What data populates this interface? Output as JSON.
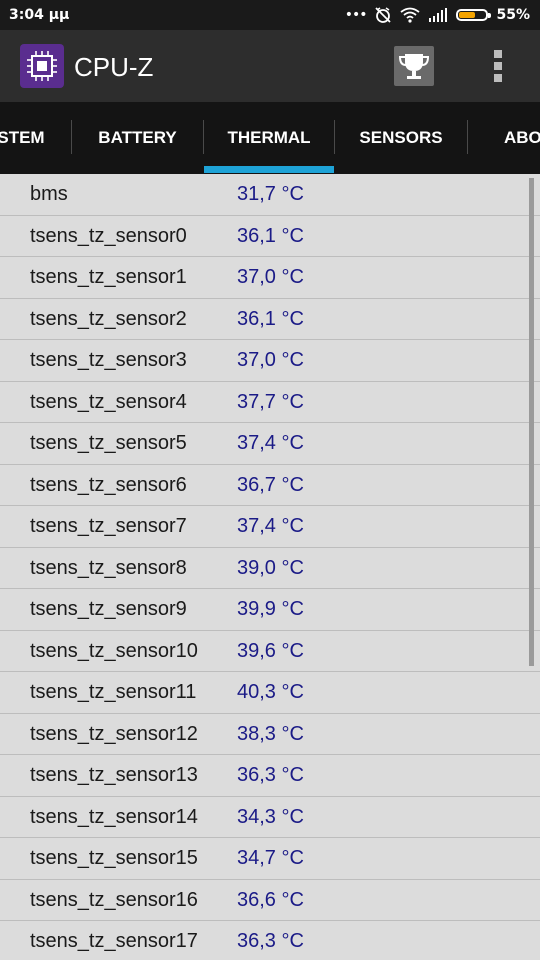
{
  "status_bar": {
    "time": "3:04 μμ",
    "battery_percent": "55%",
    "battery_level": 0.55
  },
  "app_bar": {
    "title": "CPU-Z",
    "icons": [
      "cpu-chip-logo",
      "trophy-icon",
      "more-vert-icon"
    ]
  },
  "tabs": [
    {
      "label": "STEM"
    },
    {
      "label": "BATTERY"
    },
    {
      "label": "THERMAL",
      "selected": true
    },
    {
      "label": "SENSORS"
    },
    {
      "label": "ABO"
    }
  ],
  "thermal": [
    {
      "name": "bms",
      "value": "31,7 °C"
    },
    {
      "name": "tsens_tz_sensor0",
      "value": "36,1 °C"
    },
    {
      "name": "tsens_tz_sensor1",
      "value": "37,0 °C"
    },
    {
      "name": "tsens_tz_sensor2",
      "value": "36,1 °C"
    },
    {
      "name": "tsens_tz_sensor3",
      "value": "37,0 °C"
    },
    {
      "name": "tsens_tz_sensor4",
      "value": "37,7 °C"
    },
    {
      "name": "tsens_tz_sensor5",
      "value": "37,4 °C"
    },
    {
      "name": "tsens_tz_sensor6",
      "value": "36,7 °C"
    },
    {
      "name": "tsens_tz_sensor7",
      "value": "37,4 °C"
    },
    {
      "name": "tsens_tz_sensor8",
      "value": "39,0 °C"
    },
    {
      "name": "tsens_tz_sensor9",
      "value": "39,9 °C"
    },
    {
      "name": "tsens_tz_sensor10",
      "value": "39,6 °C"
    },
    {
      "name": "tsens_tz_sensor11",
      "value": "40,3 °C"
    },
    {
      "name": "tsens_tz_sensor12",
      "value": "38,3 °C"
    },
    {
      "name": "tsens_tz_sensor13",
      "value": "36,3 °C"
    },
    {
      "name": "tsens_tz_sensor14",
      "value": "34,3 °C"
    },
    {
      "name": "tsens_tz_sensor15",
      "value": "34,7 °C"
    },
    {
      "name": "tsens_tz_sensor16",
      "value": "36,6 °C"
    },
    {
      "name": "tsens_tz_sensor17",
      "value": "36,3 °C"
    }
  ],
  "colors": {
    "status_bar": "#1a1a1a",
    "app_bar": "#2d2d2d",
    "tab_bar": "#141414",
    "tab_indicator": "#1ea3d7",
    "list_background": "#dcdcdc",
    "value_text": "#1b1b87",
    "logo_background": "#5a2d8f"
  }
}
